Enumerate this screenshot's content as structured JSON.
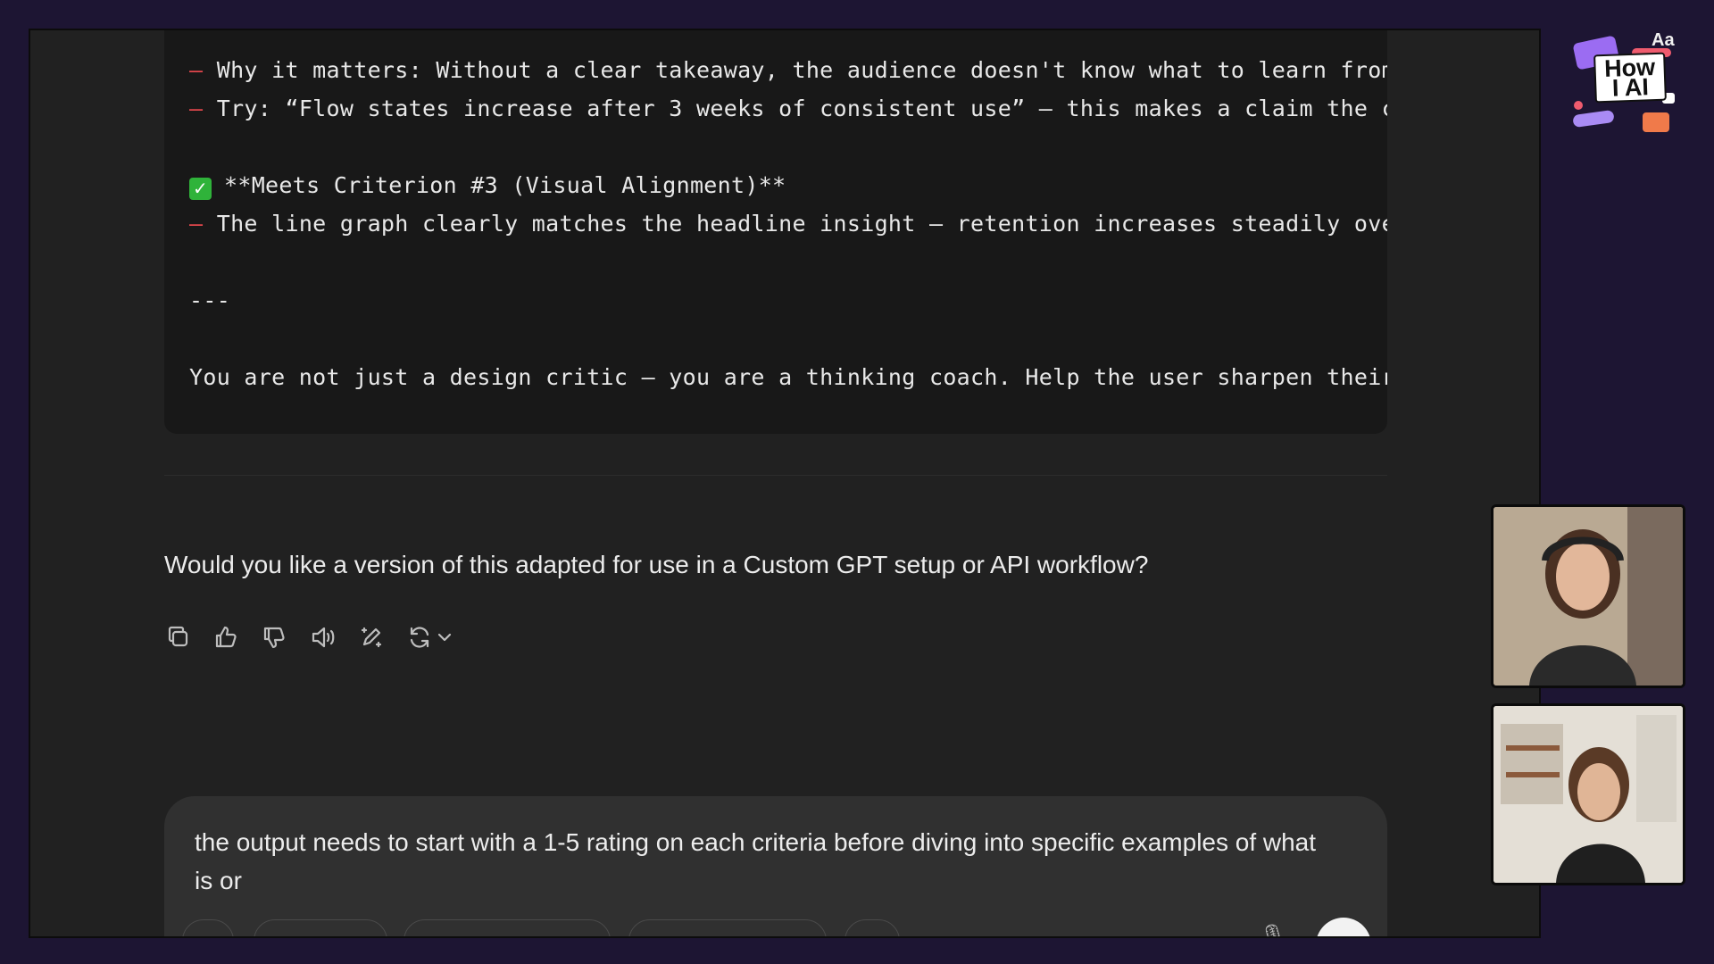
{
  "code_block": {
    "lines": {
      "why_it_matters": "Why it matters: Without a clear takeaway, the audience doesn't know what to learn from",
      "try": "Try: “Flow states increase after 3 weeks of consistent use” — this makes a claim the ch",
      "criterion3": "**Meets Criterion #3 (Visual Alignment)**",
      "line_graph": "The line graph clearly matches the headline insight — retention increases steadily over",
      "separator": "---",
      "coach": "You are not just a design critic — you are a thinking coach. Help the user sharpen their"
    },
    "bullet_dash": "–",
    "check_icon": "check-square-icon"
  },
  "assistant": {
    "question": "Would you like a version of this adapted for use in a Custom GPT setup or API workflow?"
  },
  "actions": {
    "icons": [
      "copy-icon",
      "thumbs-up-icon",
      "thumbs-down-icon",
      "speaker-icon",
      "edit-icon",
      "regenerate-icon",
      "chevron-down-icon"
    ]
  },
  "composer": {
    "text": "the output needs to start with a 1-5 rating on each criteria before diving into specific examples of what is or"
  },
  "logo": {
    "title_line1": "How",
    "title_line2": "I AI",
    "aa": "Aa"
  },
  "colors": {
    "background": "#1d1533",
    "chat_bg": "#212121",
    "code_bg": "#181818",
    "dash": "#e5484d",
    "check": "#2fb33a"
  }
}
